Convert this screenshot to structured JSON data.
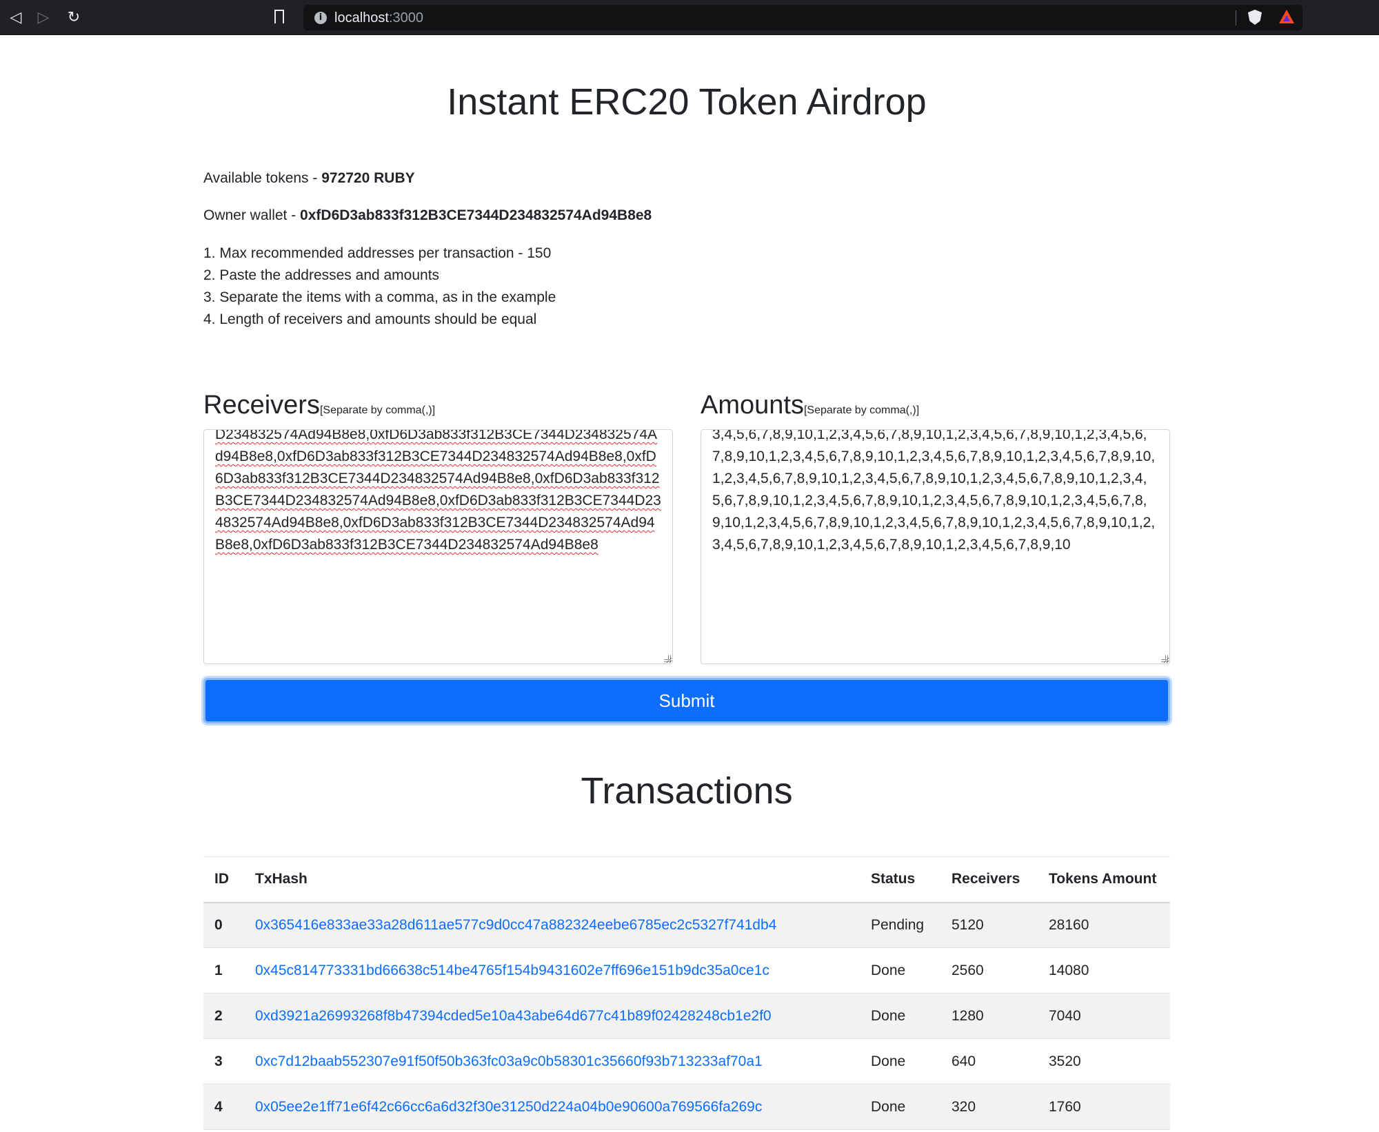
{
  "browser": {
    "url_host": "localhost",
    "url_port": ":3000"
  },
  "header": {
    "title": "Instant ERC20 Token Airdrop"
  },
  "info": {
    "available_label": "Available tokens - ",
    "available_value": "972720 RUBY",
    "owner_label": "Owner wallet - ",
    "owner_value": "0xfD6D3ab833f312B3CE7344D234832574Ad94B8e8"
  },
  "rules": [
    "1. Max recommended addresses per transaction - 150",
    "2. Paste the addresses and amounts",
    "3. Separate the items with a comma, as in the example",
    "4. Length of receivers and amounts should be equal"
  ],
  "receivers": {
    "label": "Receivers",
    "hint": "[Separate by comma(,)]",
    "value": "D234832574Ad94B8e8,0xfD6D3ab833f312B3CE7344D234832574Ad94B8e8,0xfD6D3ab833f312B3CE7344D234832574Ad94B8e8,0xfD6D3ab833f312B3CE7344D234832574Ad94B8e8,0xfD6D3ab833f312B3CE7344D234832574Ad94B8e8,0xfD6D3ab833f312B3CE7344D234832574Ad94B8e8,0xfD6D3ab833f312B3CE7344D234832574Ad94B8e8,0xfD6D3ab833f312B3CE7344D234832574Ad94B8e8"
  },
  "amounts": {
    "label": "Amounts",
    "hint": "[Separate by comma(,)]",
    "value": "3,4,5,6,7,8,9,10,1,2,3,4,5,6,7,8,9,10,1,2,3,4,5,6,7,8,9,10,1,2,3,4,5,6,7,8,9,10,1,2,3,4,5,6,7,8,9,10,1,2,3,4,5,6,7,8,9,10,1,2,3,4,5,6,7,8,9,10,1,2,3,4,5,6,7,8,9,10,1,2,3,4,5,6,7,8,9,10,1,2,3,4,5,6,7,8,9,10,1,2,3,4,5,6,7,8,9,10,1,2,3,4,5,6,7,8,9,10,1,2,3,4,5,6,7,8,9,10,1,2,3,4,5,6,7,8,9,10,1,2,3,4,5,6,7,8,9,10,1,2,3,4,5,6,7,8,9,10,1,2,3,4,5,6,7,8,9,10,1,2,3,4,5,6,7,8,9,10,1,2,3,4,5,6,7,8,9,10,1,2,3,4,5,6,7,8,9,10"
  },
  "submit_label": "Submit",
  "transactions": {
    "title": "Transactions",
    "columns": [
      "ID",
      "TxHash",
      "Status",
      "Receivers",
      "Tokens Amount"
    ],
    "rows": [
      {
        "id": "0",
        "hash": "0x365416e833ae33a28d611ae577c9d0cc47a882324eebe6785ec2c5327f741db4",
        "status": "Pending",
        "receivers": "5120",
        "amount": "28160"
      },
      {
        "id": "1",
        "hash": "0x45c814773331bd66638c514be4765f154b9431602e7ff696e151b9dc35a0ce1c",
        "status": "Done",
        "receivers": "2560",
        "amount": "14080"
      },
      {
        "id": "2",
        "hash": "0xd3921a26993268f8b47394cded5e10a43abe64d677c41b89f02428248cb1e2f0",
        "status": "Done",
        "receivers": "1280",
        "amount": "7040"
      },
      {
        "id": "3",
        "hash": "0xc7d12baab552307e91f50f50b363fc03a9c0b58301c35660f93b713233af70a1",
        "status": "Done",
        "receivers": "640",
        "amount": "3520"
      },
      {
        "id": "4",
        "hash": "0x05ee2e1ff71e6f42c66cc6a6d32f30e31250d224a04b0e90600a769566fa269c",
        "status": "Done",
        "receivers": "320",
        "amount": "1760"
      }
    ]
  },
  "icons": {
    "back": "back-arrow-icon",
    "forward": "forward-arrow-icon",
    "reload": "reload-icon",
    "bookmark": "bookmark-icon",
    "site_info": "info-icon",
    "brave_shields": "brave-lion-icon",
    "brave_rewards": "rewards-triangle-icon"
  }
}
